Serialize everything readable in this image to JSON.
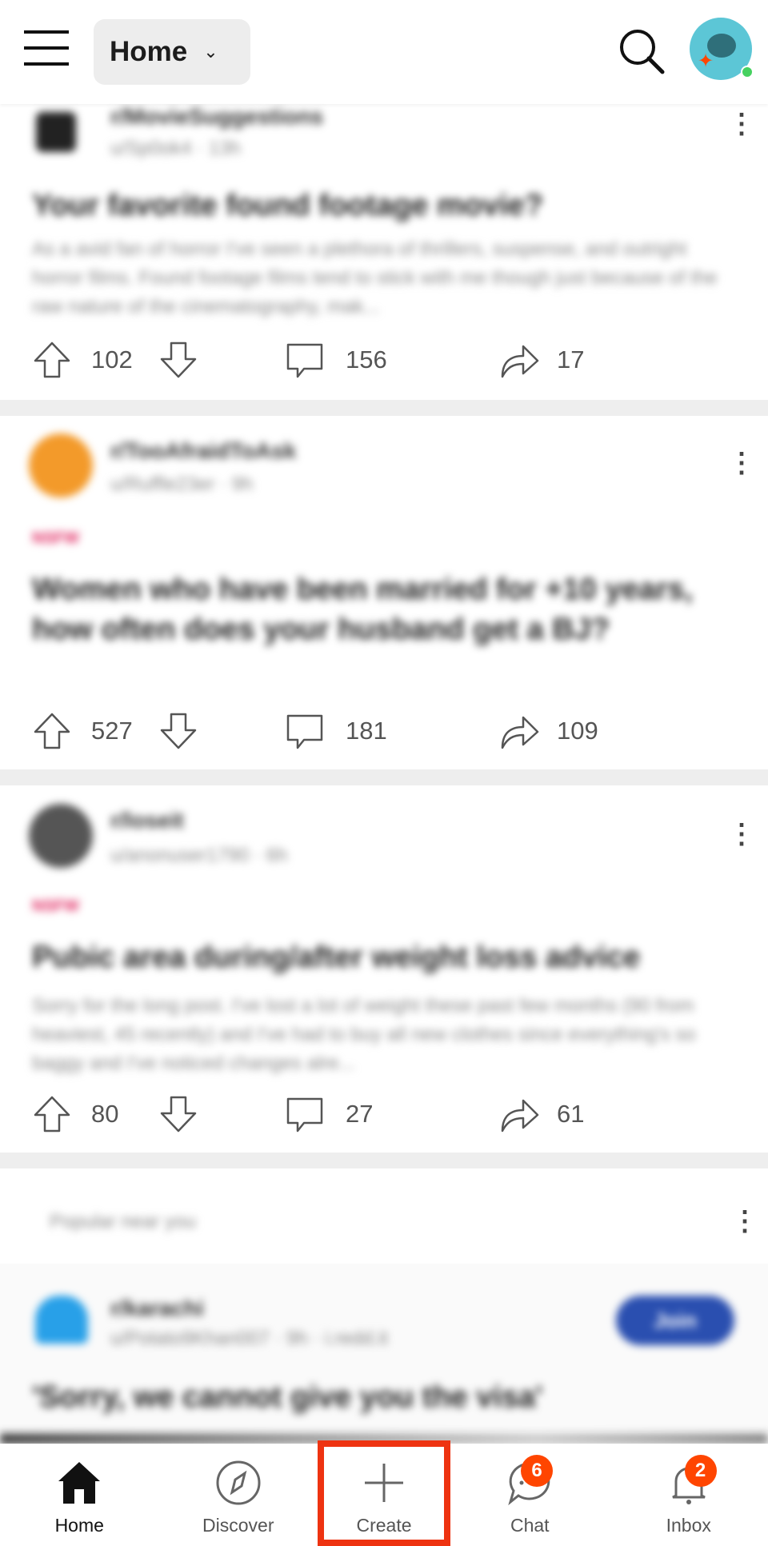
{
  "header": {
    "feed_label": "Home"
  },
  "posts": [
    {
      "subreddit": "r/MovieSuggestions",
      "meta": "u/Sp0ok4 · 13h",
      "title": "Your favorite found footage movie?",
      "body": "As a avid fan of horror I've seen a plethora of thrillers, suspense, and outright horror films. Found footage films tend to stick with me though just because of the raw nature of the cinematography, mak...",
      "upvotes": "102",
      "comments": "156",
      "shares": "17"
    },
    {
      "subreddit": "r/TooAfraidToAsk",
      "meta": "u/Ruffle23er · 9h",
      "tag": "NSFW",
      "title": "Women who have been married for +10 years, how often does your husband get a BJ?",
      "upvotes": "527",
      "comments": "181",
      "shares": "109"
    },
    {
      "subreddit": "r/loseit",
      "meta": "u/anonuser1790 · 6h",
      "tag": "NSFW",
      "title": "Pubic area during/after weight loss advice",
      "body": "Sorry for the long post. I've lost a lot of weight these past few months (90 from heaviest, 45 recently) and I've had to buy all new clothes since everything's so baggy and I've noticed changes alre...",
      "upvotes": "80",
      "comments": "27",
      "shares": "61"
    }
  ],
  "popular": {
    "label": "Popular near you",
    "subreddit": "r/karachi",
    "meta": "u/Potato9Khan007 · 9h · i.redd.it",
    "join_label": "Join",
    "title": "'Sorry, we cannot give you the visa'"
  },
  "nav": [
    {
      "label": "Home"
    },
    {
      "label": "Discover"
    },
    {
      "label": "Create"
    },
    {
      "label": "Chat",
      "badge": "6"
    },
    {
      "label": "Inbox",
      "badge": "2"
    }
  ],
  "colors": {
    "accent": "#ff4500",
    "highlight": "#ee3311",
    "join": "#2a4fb0",
    "online": "#46d160"
  }
}
